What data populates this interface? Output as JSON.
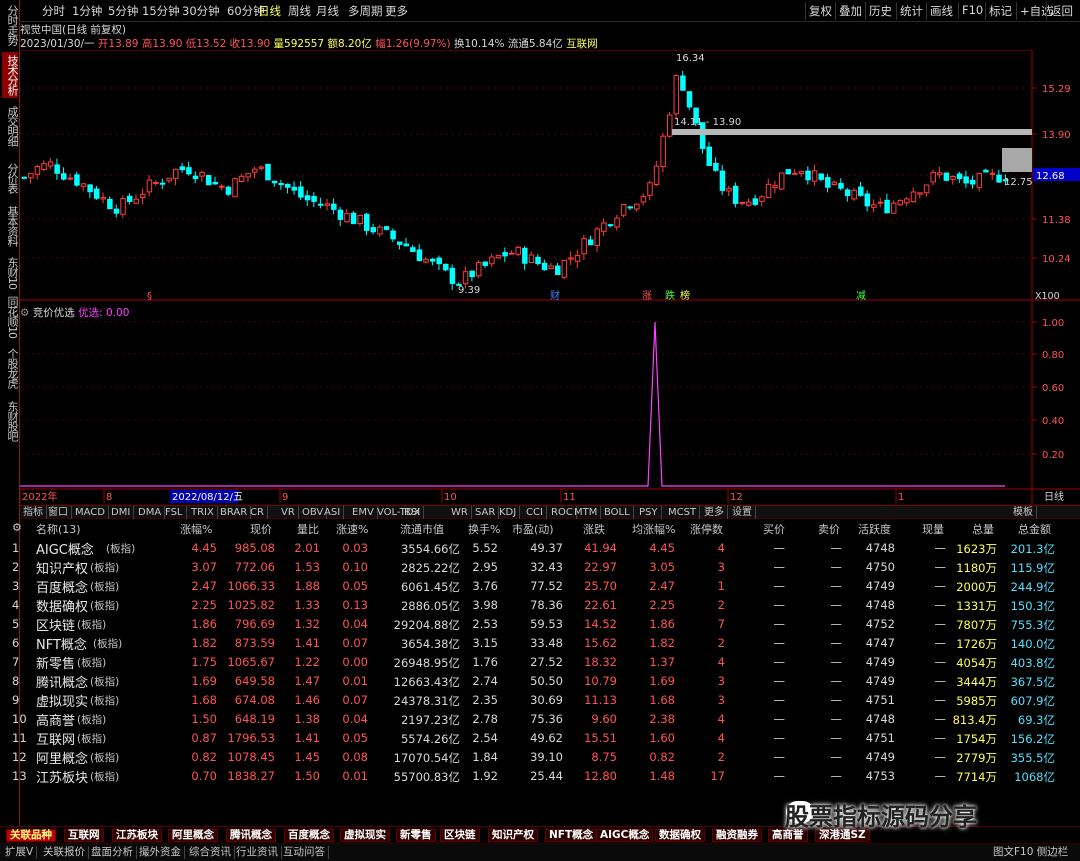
{
  "topbar": {
    "periods": [
      "分时",
      "1分钟",
      "5分钟",
      "15分钟",
      "30分钟",
      "60分钟",
      "日线",
      "周线",
      "月线",
      "多周期",
      "更多"
    ],
    "active_period": "日线",
    "right_buttons": [
      "复权",
      "叠加",
      "历史",
      "统计",
      "画线",
      "F10",
      "标记",
      "+自选",
      "返回"
    ]
  },
  "leftnav": [
    "分时走势",
    "技术分析",
    "成交明细",
    "分价表",
    "基本资料",
    "东财10",
    "同花顺10",
    "个股龙虎",
    "东财股吧"
  ],
  "leftnav_active": "技术分析",
  "info": {
    "title": "视觉中国(日线 前复权)",
    "date": "2023/01/30/一",
    "open_label": "开",
    "open": "13.89",
    "high_label": "高",
    "high": "13.90",
    "low_label": "低",
    "low": "13.52",
    "close_label": "收",
    "close": "13.90",
    "vol_label": "量",
    "vol": "592557",
    "amt_label": "额",
    "amt": "8.20亿",
    "chg_label": "幅",
    "chg": "1.26(9.97%)",
    "turn_label": "换",
    "turn": "10.14%",
    "float_label": "流通",
    "float": "5.84亿",
    "sector": "互联网"
  },
  "price_axis": [
    "15.29",
    "13.90",
    "12.68",
    "11.38",
    "10.24"
  ],
  "price_axis_current": "12.68",
  "price_annotations": {
    "high": "16.34",
    "low": "9.39",
    "range": "14.11 - 13.90",
    "last": "12.75"
  },
  "price_marks": [
    "财",
    "涨",
    "跌",
    "榜",
    "减"
  ],
  "x_scale": "X100",
  "indicator": {
    "name": "竞价优选",
    "line_label": "优选:",
    "line_value": "0.00",
    "axis": [
      "1.00",
      "0.80",
      "0.60",
      "0.40",
      "0.20"
    ]
  },
  "date_axis": {
    "labels": [
      "2022年",
      "8",
      "9",
      "10",
      "11",
      "12",
      "1"
    ],
    "cursor": "2022/08/12/五",
    "right_label": "日线"
  },
  "indicator_tabs": [
    "指标",
    "窗口",
    "MACD",
    "DMI",
    "DMA",
    "FSL",
    "TRIX",
    "BRAR",
    "CR",
    "VR",
    "OBV",
    "ASI",
    "EMV",
    "VOL-TDX",
    "RSI",
    "WR",
    "SAR",
    "KDJ",
    "CCI",
    "ROC",
    "MTM",
    "BOLL",
    "PSY",
    "MCST",
    "更多",
    "设置"
  ],
  "indicator_tabs_right": "模板",
  "table": {
    "headers": [
      "名称(13)",
      "涨幅%",
      "现价",
      "量比",
      "涨速%",
      "流通市值",
      "换手%",
      "市盈(动)",
      "涨跌",
      "均涨幅%",
      "涨停数",
      "买价",
      "卖价",
      "活跃度",
      "现量",
      "总量",
      "总金额"
    ],
    "rows": [
      {
        "no": "1",
        "name": "AIGC概念",
        "tag": "(板指)",
        "chg": "4.45",
        "price": "985.08",
        "vr": "2.01",
        "spd": "0.03",
        "mcap": "3554.66亿",
        "turn": "5.52",
        "pe": "49.37",
        "diff": "41.94",
        "avg": "4.45",
        "zt": "4",
        "buy": "—",
        "sell": "—",
        "act": "4748",
        "cur": "—",
        "vol": "1623万",
        "amt": "201.3亿"
      },
      {
        "no": "2",
        "name": "知识产权",
        "tag": "(板指)",
        "chg": "3.07",
        "price": "772.06",
        "vr": "1.53",
        "spd": "0.10",
        "mcap": "2825.22亿",
        "turn": "2.95",
        "pe": "32.43",
        "diff": "22.97",
        "avg": "3.05",
        "zt": "3",
        "buy": "—",
        "sell": "—",
        "act": "4750",
        "cur": "—",
        "vol": "1180万",
        "amt": "115.9亿"
      },
      {
        "no": "3",
        "name": "百度概念",
        "tag": "(板指)",
        "chg": "2.47",
        "price": "1066.33",
        "vr": "1.88",
        "spd": "0.05",
        "mcap": "6061.45亿",
        "turn": "3.76",
        "pe": "77.52",
        "diff": "25.70",
        "avg": "2.47",
        "zt": "1",
        "buy": "—",
        "sell": "—",
        "act": "4749",
        "cur": "—",
        "vol": "2000万",
        "amt": "244.9亿"
      },
      {
        "no": "4",
        "name": "数据确权",
        "tag": "(板指)",
        "chg": "2.25",
        "price": "1025.82",
        "vr": "1.33",
        "spd": "0.13",
        "mcap": "2886.05亿",
        "turn": "3.98",
        "pe": "78.36",
        "diff": "22.61",
        "avg": "2.25",
        "zt": "2",
        "buy": "—",
        "sell": "—",
        "act": "4748",
        "cur": "—",
        "vol": "1331万",
        "amt": "150.3亿"
      },
      {
        "no": "5",
        "name": "区块链",
        "tag": "(板指)",
        "chg": "1.86",
        "price": "796.69",
        "vr": "1.32",
        "spd": "0.04",
        "mcap": "29204.88亿",
        "turn": "2.53",
        "pe": "59.53",
        "diff": "14.52",
        "avg": "1.86",
        "zt": "7",
        "buy": "—",
        "sell": "—",
        "act": "4752",
        "cur": "—",
        "vol": "7807万",
        "amt": "755.3亿"
      },
      {
        "no": "6",
        "name": "NFT概念",
        "tag": "(板指)",
        "chg": "1.82",
        "price": "873.59",
        "vr": "1.41",
        "spd": "0.07",
        "mcap": "3654.38亿",
        "turn": "3.15",
        "pe": "33.48",
        "diff": "15.62",
        "avg": "1.82",
        "zt": "2",
        "buy": "—",
        "sell": "—",
        "act": "4747",
        "cur": "—",
        "vol": "1726万",
        "amt": "140.0亿"
      },
      {
        "no": "7",
        "name": "新零售",
        "tag": "(板指)",
        "chg": "1.75",
        "price": "1065.67",
        "vr": "1.22",
        "spd": "0.00",
        "mcap": "26948.95亿",
        "turn": "1.76",
        "pe": "27.52",
        "diff": "18.32",
        "avg": "1.37",
        "zt": "4",
        "buy": "—",
        "sell": "—",
        "act": "4749",
        "cur": "—",
        "vol": "4054万",
        "amt": "403.8亿"
      },
      {
        "no": "8",
        "name": "腾讯概念",
        "tag": "(板指)",
        "chg": "1.69",
        "price": "649.58",
        "vr": "1.47",
        "spd": "0.01",
        "mcap": "12663.43亿",
        "turn": "2.74",
        "pe": "50.50",
        "diff": "10.79",
        "avg": "1.69",
        "zt": "3",
        "buy": "—",
        "sell": "—",
        "act": "4749",
        "cur": "—",
        "vol": "3444万",
        "amt": "367.5亿"
      },
      {
        "no": "9",
        "name": "虚拟现实",
        "tag": "(板指)",
        "chg": "1.68",
        "price": "674.08",
        "vr": "1.46",
        "spd": "0.07",
        "mcap": "24378.31亿",
        "turn": "2.35",
        "pe": "30.69",
        "diff": "11.13",
        "avg": "1.68",
        "zt": "3",
        "buy": "—",
        "sell": "—",
        "act": "4751",
        "cur": "—",
        "vol": "5985万",
        "amt": "607.9亿"
      },
      {
        "no": "10",
        "name": "高商誉",
        "tag": "(板指)",
        "chg": "1.50",
        "price": "648.19",
        "vr": "1.38",
        "spd": "0.04",
        "mcap": "2197.23亿",
        "turn": "2.78",
        "pe": "75.36",
        "diff": "9.60",
        "avg": "2.38",
        "zt": "4",
        "buy": "—",
        "sell": "—",
        "act": "4748",
        "cur": "—",
        "vol": "813.4万",
        "amt": "69.3亿"
      },
      {
        "no": "11",
        "name": "互联网",
        "tag": "(板指)",
        "chg": "0.87",
        "price": "1796.53",
        "vr": "1.41",
        "spd": "0.05",
        "mcap": "5574.26亿",
        "turn": "2.54",
        "pe": "49.62",
        "diff": "15.51",
        "avg": "1.60",
        "zt": "4",
        "buy": "—",
        "sell": "—",
        "act": "4751",
        "cur": "—",
        "vol": "1754万",
        "amt": "156.2亿"
      },
      {
        "no": "12",
        "name": "阿里概念",
        "tag": "(板指)",
        "chg": "0.82",
        "price": "1078.45",
        "vr": "1.45",
        "spd": "0.08",
        "mcap": "17070.54亿",
        "turn": "1.84",
        "pe": "39.10",
        "diff": "8.75",
        "avg": "0.82",
        "zt": "2",
        "buy": "—",
        "sell": "—",
        "act": "4749",
        "cur": "—",
        "vol": "2779万",
        "amt": "355.5亿"
      },
      {
        "no": "13",
        "name": "江苏板块",
        "tag": "(板指)",
        "chg": "0.70",
        "price": "1838.27",
        "vr": "1.50",
        "spd": "0.01",
        "mcap": "55700.83亿",
        "turn": "1.92",
        "pe": "25.44",
        "diff": "12.80",
        "avg": "1.48",
        "zt": "17",
        "buy": "—",
        "sell": "—",
        "act": "4753",
        "cur": "—",
        "vol": "7714万",
        "amt": "1068亿"
      }
    ]
  },
  "bottom_tabs": [
    "关联品种",
    "互联网",
    "江苏板块",
    "阿里概念",
    "腾讯概念",
    "百度概念",
    "虚拟现实",
    "新零售",
    "区块链",
    "知识产权",
    "NFT概念",
    "AIGC概念",
    "数据确权",
    "融资融券",
    "高商誉",
    "深港通SZ"
  ],
  "status_bar": [
    "扩展V",
    "关联报价",
    "盘面分析",
    "撮外资金",
    "综合资讯",
    "行业资讯",
    "互动问答"
  ],
  "status_right": "图文F10 侧边栏",
  "watermark": "股票指标源码分享",
  "colors": {
    "up": "#ff5454",
    "down": "#54ffff",
    "axis": "#a00000"
  }
}
